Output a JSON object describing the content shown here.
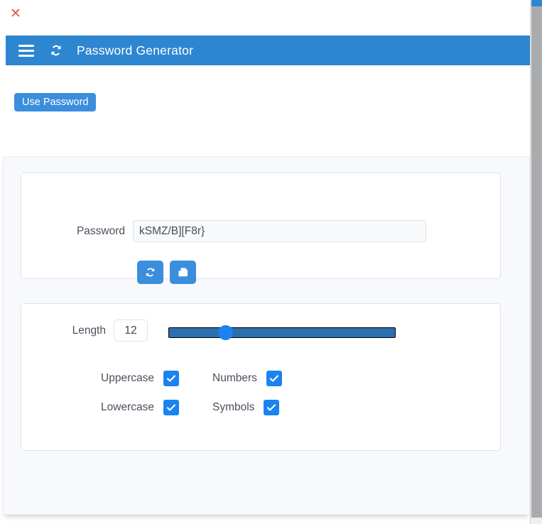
{
  "window": {
    "close_label": "✕"
  },
  "appbar": {
    "menu_icon": "hamburger-icon",
    "sync_icon": "sync-refresh-icon",
    "title": "Password Generator",
    "background": "#2e86d1"
  },
  "toolbar": {
    "use_password_label": "Use Password",
    "use_password_color": "#3a8edd"
  },
  "password_card": {
    "label": "Password",
    "value": "kSMZ/B][F8r}",
    "placeholder": "",
    "regenerate_icon": "refresh-icon",
    "regenerate_label": "",
    "copy_icon": "copy-icon",
    "copy_label": "",
    "button_color": "#3a8edd"
  },
  "options_card": {
    "length": {
      "label": "Length",
      "value": "12",
      "min": 4,
      "max": 36,
      "percent": 25,
      "track_color": "#2c6fad",
      "thumb_color": "#1a83f0"
    },
    "checkboxes": [
      {
        "label": "Uppercase",
        "checked": true,
        "column": 1
      },
      {
        "label": "Numbers",
        "checked": true,
        "column": 2
      },
      {
        "label": "Lowercase",
        "checked": true,
        "column": 1
      },
      {
        "label": "Symbols",
        "checked": true,
        "column": 2
      }
    ],
    "checkbox_color": "#1a83f0"
  },
  "scrollbar": {
    "position": "right"
  }
}
